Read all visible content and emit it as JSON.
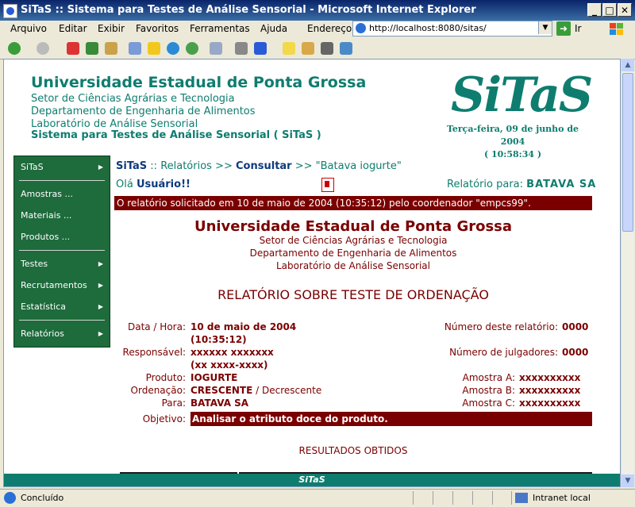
{
  "window": {
    "title": "SiTaS :: Sistema para Testes de Análise Sensorial - Microsoft Internet Explorer",
    "minimize": "_",
    "maximize": "□",
    "close": "✕"
  },
  "menu": {
    "items": [
      "Arquivo",
      "Editar",
      "Exibir",
      "Favoritos",
      "Ferramentas",
      "Ajuda"
    ],
    "address_label": "Endereço",
    "address_value": "http://localhost:8080/sitas/",
    "go_label": "Ir"
  },
  "header": {
    "university": "Universidade Estadual de Ponta Grossa",
    "sector": "Setor de Ciências Agrárias e Tecnologia",
    "department": "Departamento de Engenharia de Alimentos",
    "lab": "Laboratório de Análise Sensorial",
    "system": "Sistema para Testes de Análise Sensorial ( SiTaS )",
    "logo": "SiTaS",
    "date": "Terça-feira, 09 de junho de 2004",
    "time": "( 10:58:34 )"
  },
  "sidebar": {
    "items": [
      {
        "label": "SiTaS",
        "arrow": "▶"
      },
      {
        "label": "Amostras ...",
        "arrow": ""
      },
      {
        "label": "Materiais ...",
        "arrow": ""
      },
      {
        "label": "Produtos ...",
        "arrow": ""
      },
      {
        "label": "Testes",
        "arrow": "▶"
      },
      {
        "label": "Recrutamentos",
        "arrow": "▶"
      },
      {
        "label": "Estatística",
        "arrow": "▶"
      },
      {
        "label": "Relatórios",
        "arrow": "▶"
      }
    ]
  },
  "breadcrumb": {
    "root": "SiTaS",
    "sep1": " :: ",
    "section": "Relatórios",
    "sep2": " >> ",
    "current": "Consultar",
    "sep3": " >> ",
    "item": "\"Batava iogurte\""
  },
  "greeting": {
    "prefix": "Olá ",
    "user": "Usuário!!",
    "report_for_label": "Relatório para: ",
    "report_for_value": "BATAVA SA"
  },
  "message": "O relatório solicitado em 10 de maio de 2004 (10:35:12) pelo coordenador \"empcs99\".",
  "report": {
    "university": "Universidade Estadual de Ponta Grossa",
    "sector": "Setor de Ciências Agrárias e Tecnologia",
    "department": "Departamento de Engenharia de Alimentos",
    "lab": "Laboratório de Análise Sensorial",
    "title": "RELATÓRIO SOBRE TESTE DE ORDENAÇÃO",
    "date_label": "Data / Hora:",
    "date_value": "10 de maio de 2004",
    "time_value": "(10:35:12)",
    "responsible_label": "Responsável:",
    "responsible_value": "xxxxxx xxxxxxx",
    "responsible_phone": "(xx xxxx-xxxx)",
    "product_label": "Produto:",
    "product_value": "IOGURTE",
    "order_label": "Ordenação:",
    "order_value": "CRESCENTE",
    "order_alt": " / Decrescente",
    "for_label": "Para:",
    "for_value": "BATAVA SA",
    "objective_label": "Objetivo:",
    "objective_value": "Analisar o atributo doce do produto.",
    "report_number_label": "Número deste relatório:",
    "report_number_value": "0000",
    "judges_label": "Número de julgadores:",
    "judges_value": "0000",
    "sample_a_label": "Amostra A:",
    "sample_a_value": "xxxxxxxxxx",
    "sample_b_label": "Amostra B:",
    "sample_b_value": "xxxxxxxxxx",
    "sample_c_label": "Amostra C:",
    "sample_c_value": "xxxxxxxxxx",
    "results_heading": "RESULTADOS OBTIDOS"
  },
  "footer": "SiTaS",
  "status": {
    "text": "Concluído",
    "zone": "Intranet local"
  }
}
